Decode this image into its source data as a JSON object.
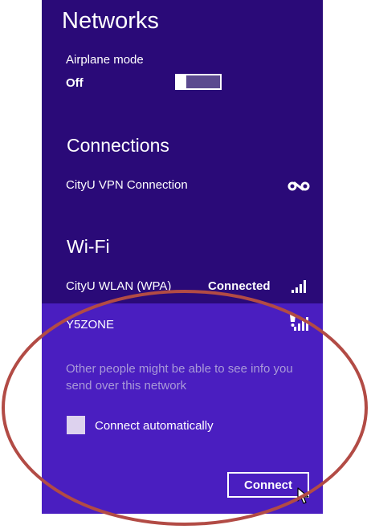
{
  "networks": {
    "title": "Networks"
  },
  "airplane_mode": {
    "label": "Airplane mode",
    "state": "Off"
  },
  "connections": {
    "heading": "Connections",
    "items": [
      {
        "label": "CityU VPN Connection",
        "icon": "vpn-icon"
      }
    ]
  },
  "wifi": {
    "heading": "Wi-Fi",
    "networks": [
      {
        "name": "CityU WLAN (WPA)",
        "status": "Connected",
        "icon": "wifi-signal-icon"
      },
      {
        "name": "Y5ZONE",
        "status": "",
        "icon": "wifi-signal-warning-icon"
      }
    ],
    "selected": {
      "warning": "Other people might be able to see info you send over this network",
      "checkbox_label": "Connect automatically",
      "checkbox_checked": false,
      "connect_label": "Connect"
    }
  },
  "colors": {
    "panel_top": "#2a0a78",
    "panel_bottom": "#4a1ec0",
    "annotation_ellipse": "#b24b45"
  }
}
